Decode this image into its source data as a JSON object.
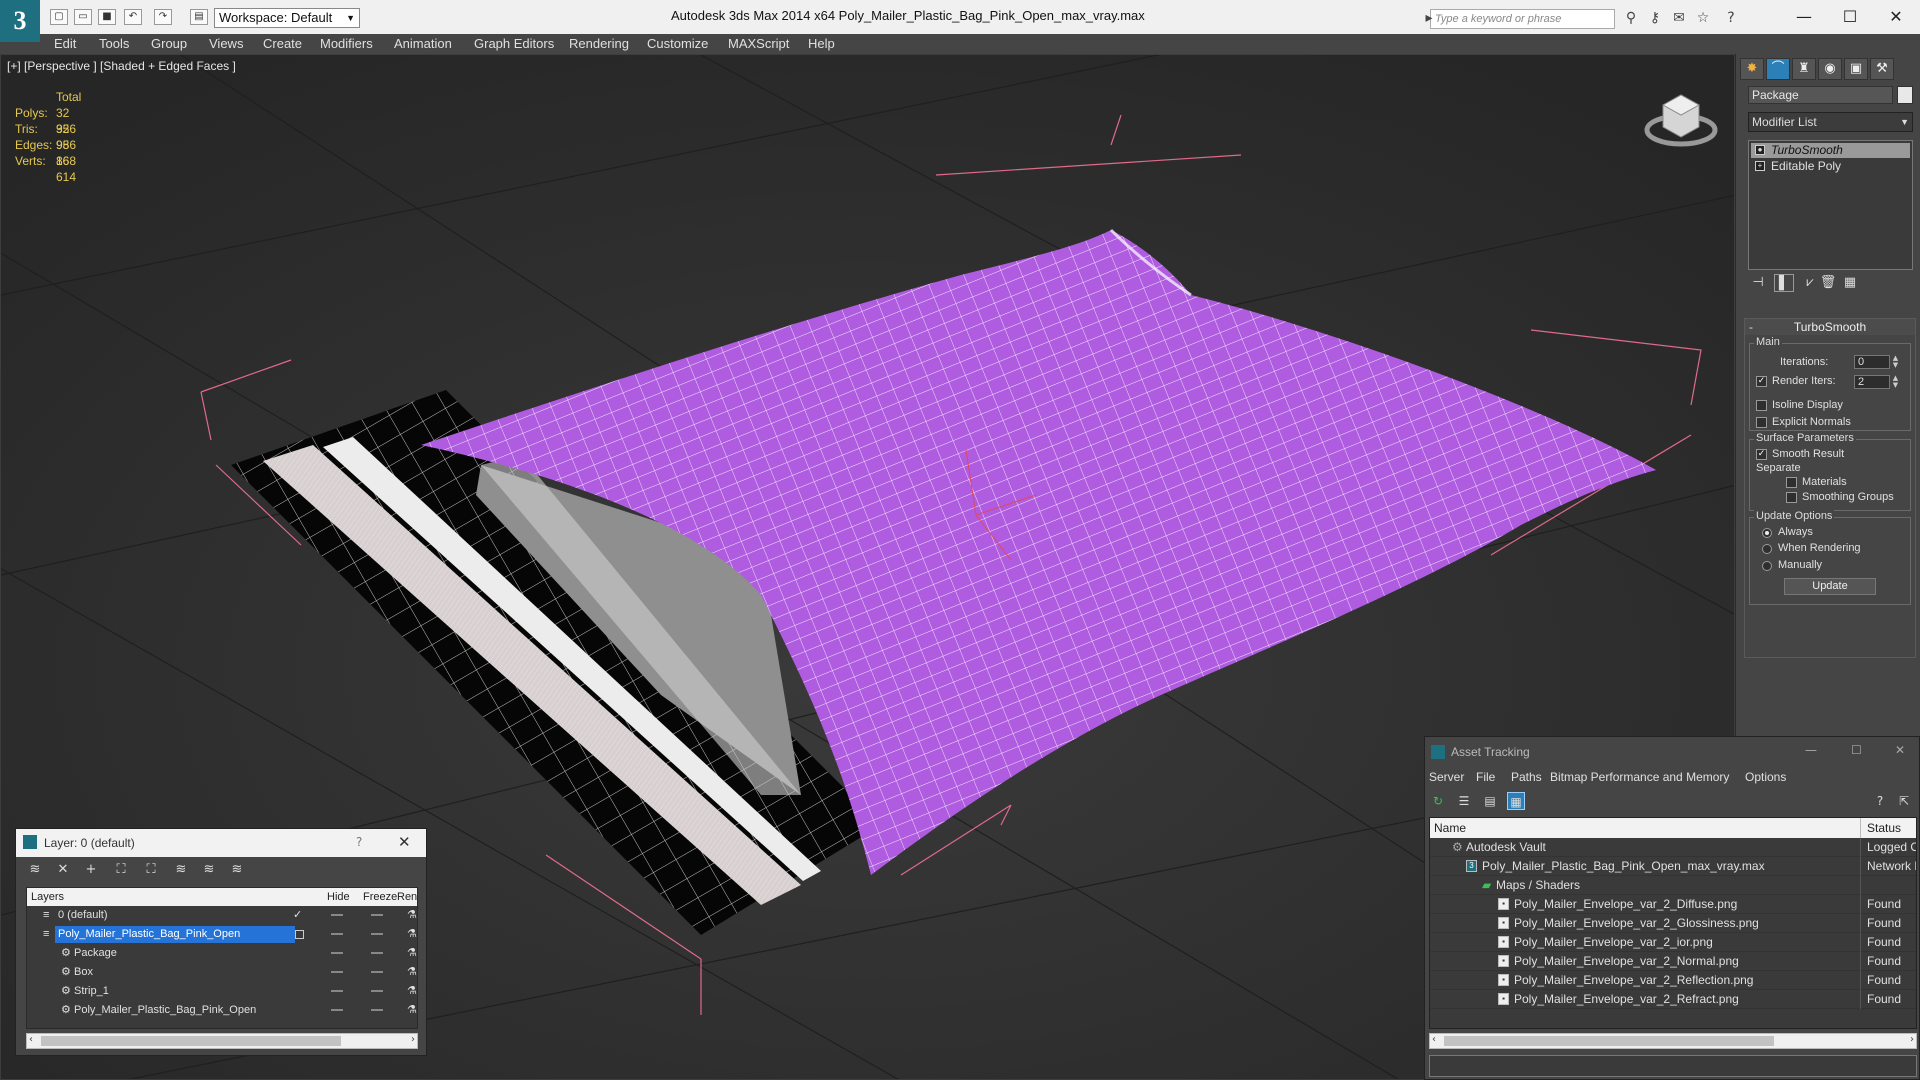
{
  "titlebar": {
    "workspace": "Workspace: Default",
    "title": "Autodesk 3ds Max  2014 x64       Poly_Mailer_Plastic_Bag_Pink_Open_max_vray.max",
    "search_placeholder": "Type a keyword or phrase"
  },
  "menu": [
    "Edit",
    "Tools",
    "Group",
    "Views",
    "Create",
    "Modifiers",
    "Animation",
    "Graph Editors",
    "Rendering",
    "Customize",
    "MAXScript",
    "Help"
  ],
  "viewport": {
    "label": "[+] [Perspective ] [Shaded + Edged Faces ]",
    "stats_header": "Total",
    "stats": [
      {
        "label": "Polys:",
        "value": "32 956"
      },
      {
        "label": "Tris:",
        "value": "32 956"
      },
      {
        "label": "Edges:",
        "value": "98 868"
      },
      {
        "label": "Verts:",
        "value": "16 614"
      }
    ],
    "mesh_color": "#b05ce0"
  },
  "command_panel": {
    "object_name": "Package",
    "modifier_list": "Modifier List",
    "stack": [
      "TurboSmooth",
      "Editable Poly"
    ],
    "rollout_title": "TurboSmooth",
    "main_group": "Main",
    "iterations_label": "Iterations:",
    "iterations_value": "0",
    "render_iters_label": "Render Iters:",
    "render_iters_value": "2",
    "isoline": "Isoline Display",
    "explicit_normals": "Explicit Normals",
    "surface_group": "Surface Parameters",
    "smooth_result": "Smooth Result",
    "separate": "Separate",
    "materials": "Materials",
    "smoothing_groups": "Smoothing Groups",
    "update_group": "Update Options",
    "always": "Always",
    "when_rendering": "When Rendering",
    "manually": "Manually",
    "update_button": "Update"
  },
  "layer_window": {
    "title": "Layer: 0 (default)",
    "help": "?",
    "columns": [
      "Layers",
      "Hide",
      "Freeze",
      "Ren"
    ],
    "rows": [
      {
        "name": "0 (default)"
      },
      {
        "name": "Poly_Mailer_Plastic_Bag_Pink_Open"
      },
      {
        "name": "Package"
      },
      {
        "name": "Box"
      },
      {
        "name": "Strip_1"
      },
      {
        "name": "Poly_Mailer_Plastic_Bag_Pink_Open"
      }
    ]
  },
  "asset_tracking": {
    "title": "Asset Tracking",
    "menu": [
      "Server",
      "File",
      "Paths",
      "Bitmap Performance and Memory",
      "Options"
    ],
    "columns": [
      "Name",
      "Status"
    ],
    "rows": [
      {
        "name": "Autodesk Vault",
        "status": "Logged Out"
      },
      {
        "name": "Poly_Mailer_Plastic_Bag_Pink_Open_max_vray.max",
        "status": "Network Pat"
      },
      {
        "name": "Maps / Shaders",
        "status": ""
      },
      {
        "name": "Poly_Mailer_Envelope_var_2_Diffuse.png",
        "status": "Found"
      },
      {
        "name": "Poly_Mailer_Envelope_var_2_Glossiness.png",
        "status": "Found"
      },
      {
        "name": "Poly_Mailer_Envelope_var_2_ior.png",
        "status": "Found"
      },
      {
        "name": "Poly_Mailer_Envelope_var_2_Normal.png",
        "status": "Found"
      },
      {
        "name": "Poly_Mailer_Envelope_var_2_Reflection.png",
        "status": "Found"
      },
      {
        "name": "Poly_Mailer_Envelope_var_2_Refract.png",
        "status": "Found"
      }
    ]
  }
}
